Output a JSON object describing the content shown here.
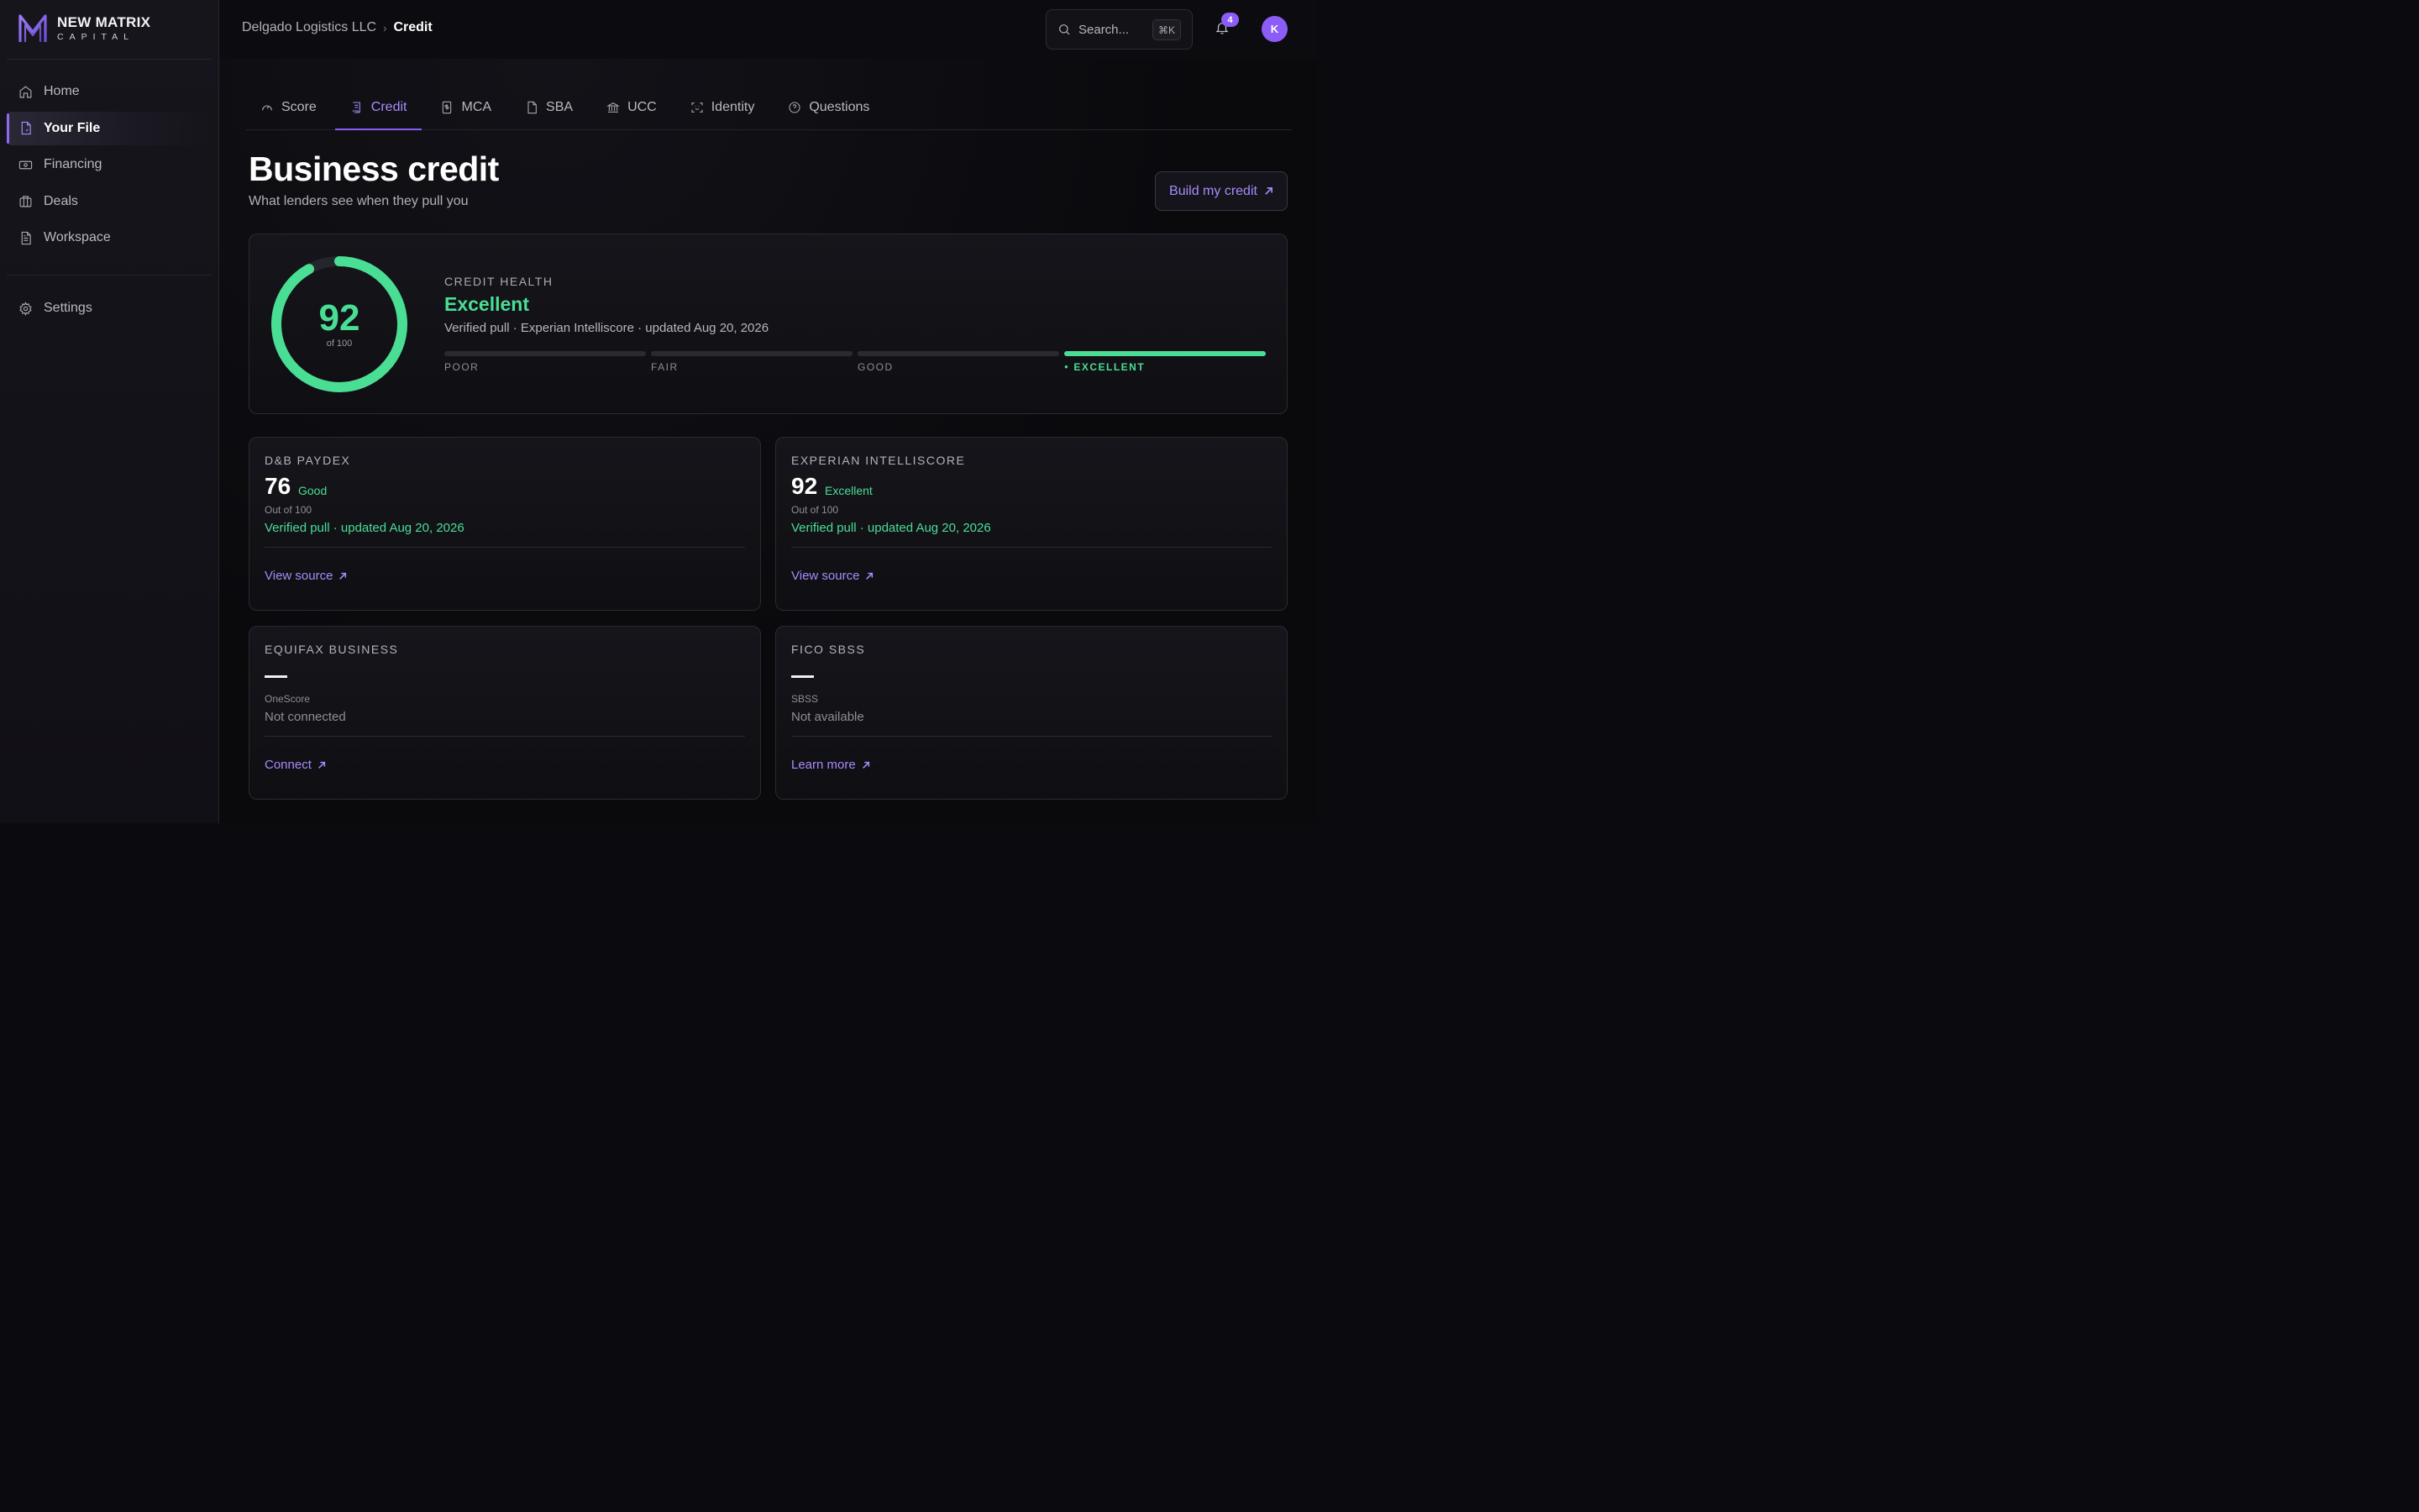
{
  "brand": {
    "name": "NEW MATRIX",
    "sub": "CAPITAL",
    "accent": "#8b5cf6"
  },
  "sidebar": {
    "items": [
      {
        "label": "Home",
        "icon": "home-icon"
      },
      {
        "label": "Your File",
        "icon": "file-icon",
        "active": true
      },
      {
        "label": "Financing",
        "icon": "banknote-icon"
      },
      {
        "label": "Deals",
        "icon": "briefcase-icon"
      },
      {
        "label": "Workspace",
        "icon": "document-icon"
      }
    ],
    "settings": {
      "label": "Settings",
      "icon": "gear-icon"
    }
  },
  "topbar": {
    "breadcrumb": {
      "parent": "Delgado Logistics LLC",
      "current": "Credit"
    },
    "search": {
      "placeholder": "Search...",
      "shortcut": "⌘K"
    },
    "notifications": {
      "count": "4"
    },
    "avatar": {
      "initial": "K"
    }
  },
  "tabs": [
    {
      "label": "Score",
      "icon": "gauge-icon"
    },
    {
      "label": "Credit",
      "icon": "receipt-icon",
      "active": true
    },
    {
      "label": "MCA",
      "icon": "dollar-doc-icon"
    },
    {
      "label": "SBA",
      "icon": "page-icon"
    },
    {
      "label": "UCC",
      "icon": "bank-icon"
    },
    {
      "label": "Identity",
      "icon": "scan-face-icon"
    },
    {
      "label": "Questions",
      "icon": "help-circle-icon"
    }
  ],
  "page": {
    "title": "Business credit",
    "subtitle": "What lenders see when they pull you",
    "action": "Build my credit"
  },
  "health": {
    "label": "CREDIT HEALTH",
    "score": "92",
    "score_of": "of 100",
    "score_fraction": 0.92,
    "rating": "Excellent",
    "meta": "Verified pull · Experian Intelliscore · updated Aug 20, 2026",
    "levels": [
      "POOR",
      "FAIR",
      "GOOD",
      "EXCELLENT"
    ],
    "active_level": 3,
    "color": "#4ade95"
  },
  "scores": [
    {
      "label": "D&B PAYDEX",
      "score": "76",
      "rating": "Good",
      "out_of": "Out of 100",
      "status": "Verified pull · updated Aug 20, 2026",
      "link": "View source"
    },
    {
      "label": "EXPERIAN INTELLISCORE",
      "score": "92",
      "rating": "Excellent",
      "out_of": "Out of 100",
      "status": "Verified pull · updated Aug 20, 2026",
      "link": "View source"
    },
    {
      "label": "EQUIFAX BUSINESS",
      "score": "",
      "rating": "",
      "out_of": "OneScore",
      "status": "Not connected",
      "link": "Connect"
    },
    {
      "label": "FICO SBSS",
      "score": "",
      "rating": "",
      "out_of": "SBSS",
      "status": "Not available",
      "link": "Learn more"
    }
  ]
}
